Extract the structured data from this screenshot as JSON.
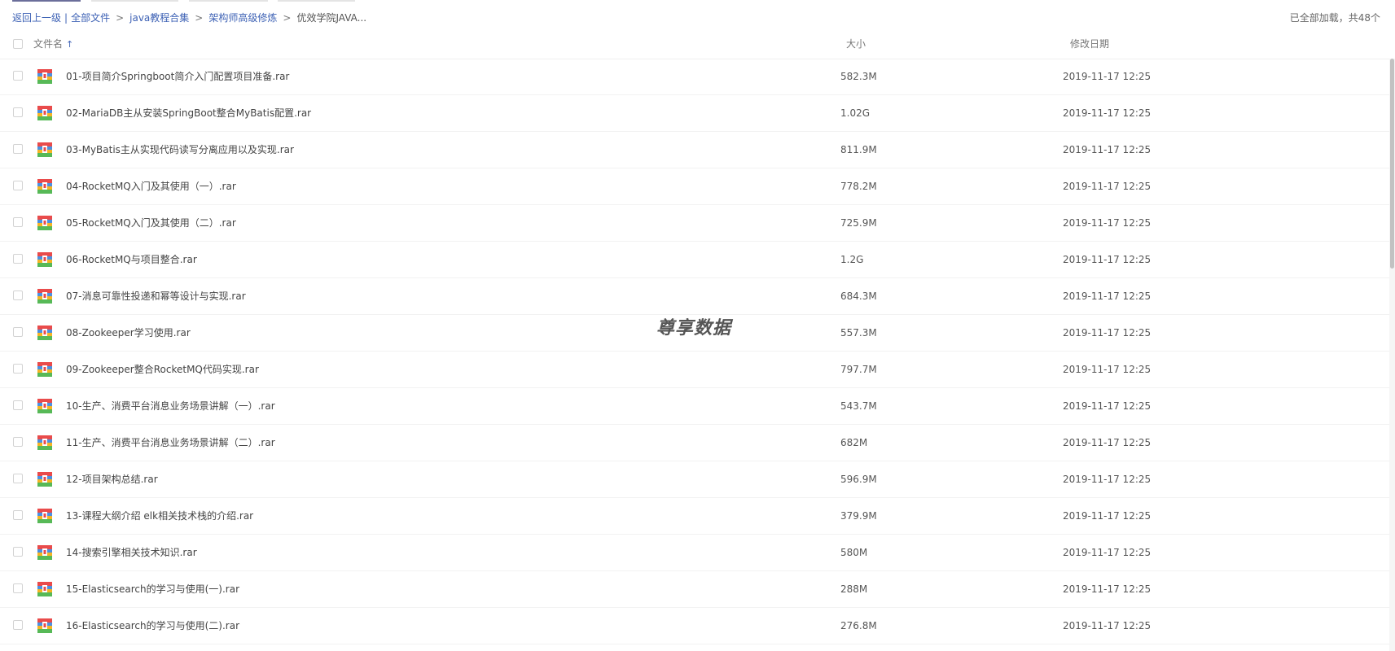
{
  "breadcrumb": {
    "back": "返回上一级",
    "pipe": "|",
    "separator": ">",
    "items": [
      "全部文件",
      "java教程合集",
      "架构师高级修炼",
      "优效学院JAVA..."
    ]
  },
  "status": {
    "loaded_text": "已全部加载，共48个"
  },
  "table": {
    "headers": {
      "name": "文件名",
      "size": "大小",
      "date": "修改日期"
    },
    "sort_indicator": "↑",
    "rows": [
      {
        "name": "01-项目简介Springboot简介入门配置项目准备.rar",
        "size": "582.3M",
        "date": "2019-11-17 12:25"
      },
      {
        "name": "02-MariaDB主从安装SpringBoot整合MyBatis配置.rar",
        "size": "1.02G",
        "date": "2019-11-17 12:25"
      },
      {
        "name": "03-MyBatis主从实现代码读写分离应用以及实现.rar",
        "size": "811.9M",
        "date": "2019-11-17 12:25"
      },
      {
        "name": "04-RocketMQ入门及其使用（一）.rar",
        "size": "778.2M",
        "date": "2019-11-17 12:25"
      },
      {
        "name": "05-RocketMQ入门及其使用（二）.rar",
        "size": "725.9M",
        "date": "2019-11-17 12:25"
      },
      {
        "name": "06-RocketMQ与项目整合.rar",
        "size": "1.2G",
        "date": "2019-11-17 12:25"
      },
      {
        "name": "07-消息可靠性投递和幂等设计与实现.rar",
        "size": "684.3M",
        "date": "2019-11-17 12:25"
      },
      {
        "name": "08-Zookeeper学习使用.rar",
        "size": "557.3M",
        "date": "2019-11-17 12:25"
      },
      {
        "name": "09-Zookeeper整合RocketMQ代码实现.rar",
        "size": "797.7M",
        "date": "2019-11-17 12:25"
      },
      {
        "name": "10-生产、消费平台消息业务场景讲解（一）.rar",
        "size": "543.7M",
        "date": "2019-11-17 12:25"
      },
      {
        "name": "11-生产、消费平台消息业务场景讲解（二）.rar",
        "size": "682M",
        "date": "2019-11-17 12:25"
      },
      {
        "name": "12-项目架构总结.rar",
        "size": "596.9M",
        "date": "2019-11-17 12:25"
      },
      {
        "name": "13-课程大纲介绍 elk相关技术栈的介绍.rar",
        "size": "379.9M",
        "date": "2019-11-17 12:25"
      },
      {
        "name": "14-搜索引擎相关技术知识.rar",
        "size": "580M",
        "date": "2019-11-17 12:25"
      },
      {
        "name": "15-Elasticsearch的学习与使用(一).rar",
        "size": "288M",
        "date": "2019-11-17 12:25"
      },
      {
        "name": "16-Elasticsearch的学习与使用(二).rar",
        "size": "276.8M",
        "date": "2019-11-17 12:25"
      }
    ]
  },
  "watermark": {
    "text": "尊享数据"
  },
  "icons": {
    "file": "rar-archive-icon",
    "sort": "sort-ascending-icon"
  },
  "colors": {
    "link": "#3e62b5",
    "text": "#444444",
    "border": "#f2f2f2",
    "muted": "#777777"
  }
}
